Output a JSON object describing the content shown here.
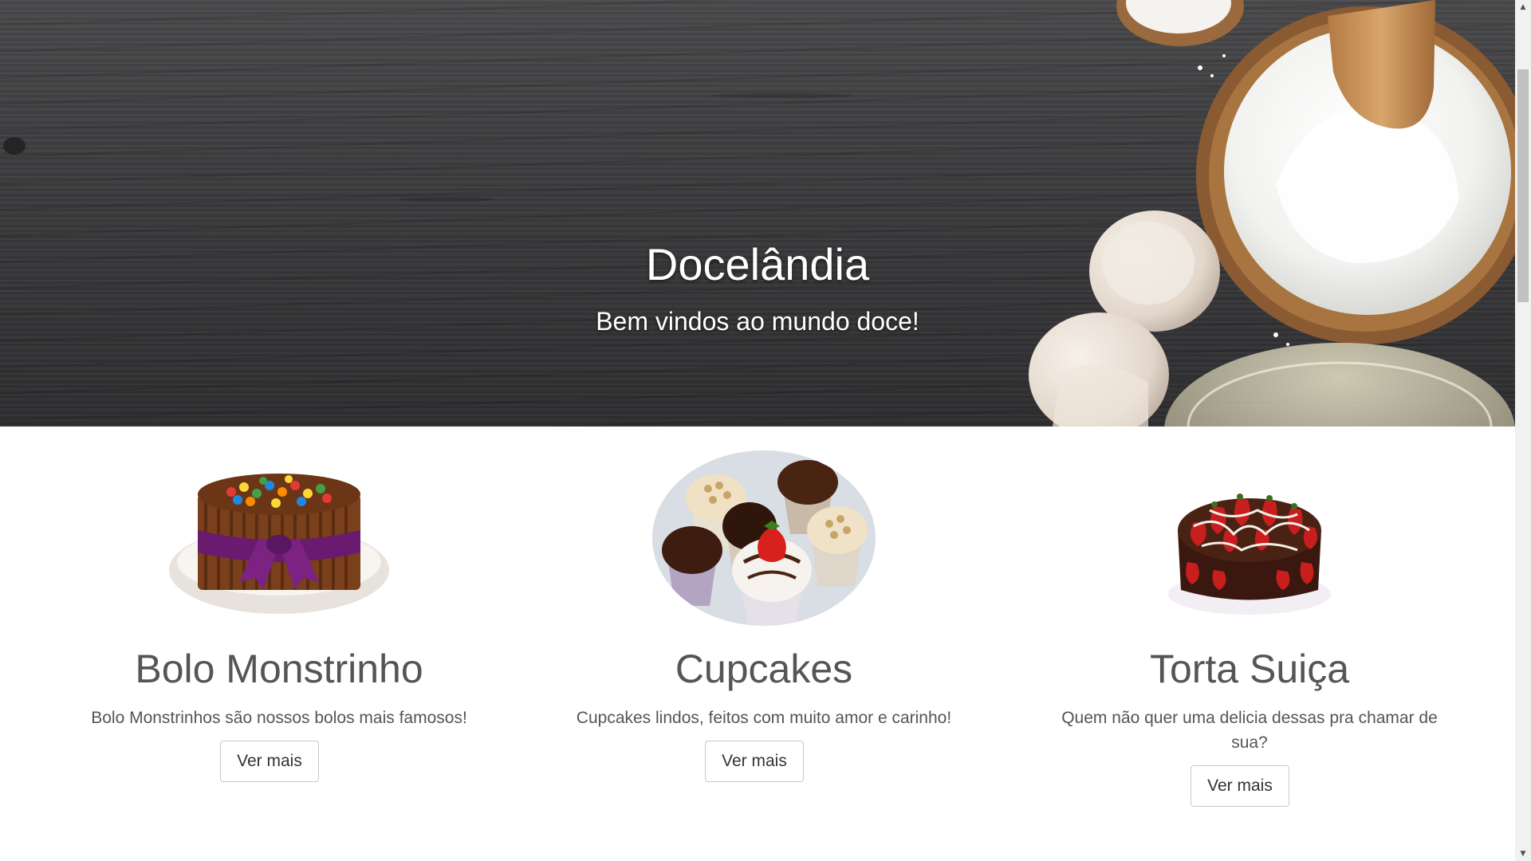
{
  "hero": {
    "title": "Docelândia",
    "subtitle": "Bem vindos ao mundo doce!"
  },
  "products": [
    {
      "name": "Bolo Monstrinho",
      "description": "Bolo Monstrinhos são nossos bolos mais famosos!",
      "button_label": "Ver mais"
    },
    {
      "name": "Cupcakes",
      "description": "Cupcakes lindos, feitos com muito amor e carinho!",
      "button_label": "Ver mais"
    },
    {
      "name": "Torta Suiça",
      "description": "Quem não quer uma delicia dessas pra chamar de sua?",
      "button_label": "Ver mais"
    }
  ],
  "colors": {
    "hero_text": "#ffffff",
    "body_text": "#555555",
    "button_border": "#c8c8c8",
    "wood": "#3c3c3e"
  },
  "scrollbar": {
    "up_icon": "triangle-up-icon",
    "down_icon": "triangle-down-icon"
  }
}
